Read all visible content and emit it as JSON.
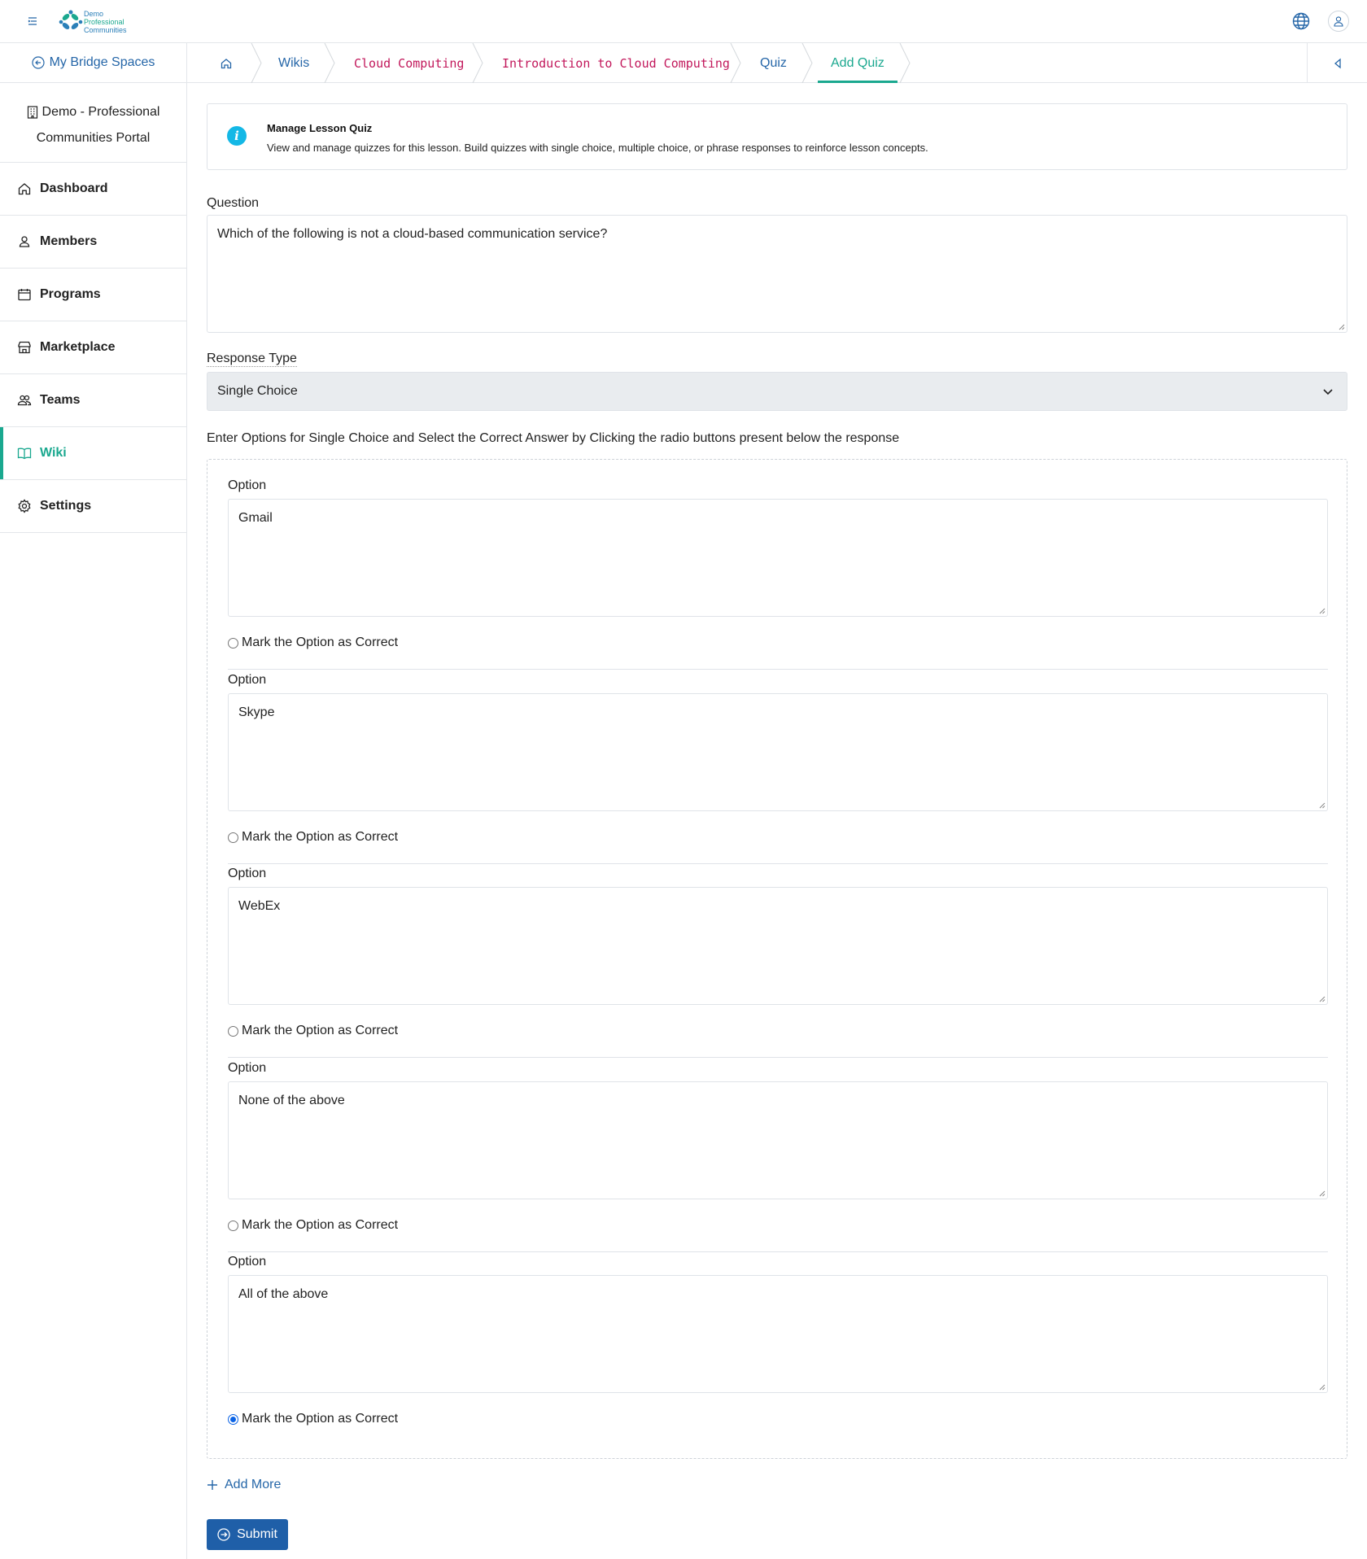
{
  "brand": {
    "logo_line1": "Demo",
    "logo_line2": "Professional",
    "logo_line3": "Communities"
  },
  "header": {
    "icons": [
      "menu-toggle-icon",
      "globe-icon",
      "user-icon"
    ]
  },
  "sidebar": {
    "back_label": "My Bridge Spaces",
    "org_line1": "Demo - Professional",
    "org_line2": "Communities Portal",
    "items": [
      {
        "label": "Dashboard",
        "icon": "home-icon"
      },
      {
        "label": "Members",
        "icon": "person-icon"
      },
      {
        "label": "Programs",
        "icon": "calendar-icon"
      },
      {
        "label": "Marketplace",
        "icon": "store-icon"
      },
      {
        "label": "Teams",
        "icon": "people-icon"
      },
      {
        "label": "Wiki",
        "icon": "book-icon",
        "active": true
      },
      {
        "label": "Settings",
        "icon": "gear-icon"
      }
    ]
  },
  "breadcrumb": {
    "items": [
      "Wikis",
      "Cloud Computing",
      "Introduction to Cloud Computing",
      "Quiz",
      "Add Quiz"
    ]
  },
  "info": {
    "title": "Manage Lesson Quiz",
    "description": "View and manage quizzes for this lesson. Build quizzes with single choice, multiple choice, or phrase responses to reinforce lesson concepts."
  },
  "form": {
    "question_label": "Question",
    "question_value": "Which of the following is not a cloud-based communication service?",
    "response_type_label": "Response Type",
    "response_type_value": "Single Choice",
    "hint": "Enter Options for Single Choice and Select the Correct Answer by Clicking the radio buttons present below the response",
    "option_label": "Option",
    "mark_correct_label": "Mark the Option as Correct",
    "options": [
      {
        "value": "Gmail",
        "correct": false
      },
      {
        "value": "Skype",
        "correct": false
      },
      {
        "value": "WebEx",
        "correct": false
      },
      {
        "value": "None of the above",
        "correct": false
      },
      {
        "value": "All of the above",
        "correct": true
      }
    ],
    "add_more_label": "Add More",
    "submit_label": "Submit"
  },
  "colors": {
    "accent_green": "#1aa88f",
    "link_blue": "#2566a8",
    "crumb_code": "#c2185b",
    "submit_bg": "#1f5fa8",
    "info_icon": "#14b8e6"
  }
}
